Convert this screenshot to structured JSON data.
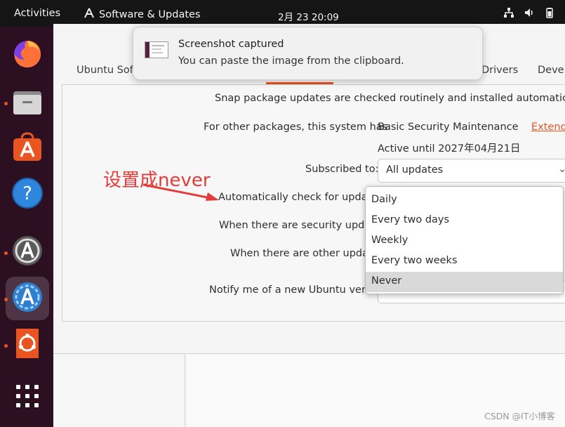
{
  "topbar": {
    "activities": "Activities",
    "app_name": "Software & Updates",
    "clock": "2月 23  20:09",
    "tray_icons": [
      "network-icon",
      "volume-icon",
      "battery-icon"
    ]
  },
  "dock": {
    "items": [
      {
        "name": "firefox-icon",
        "running": false,
        "active": false
      },
      {
        "name": "files-icon",
        "running": true,
        "active": false
      },
      {
        "name": "ubuntu-software-icon",
        "running": false,
        "active": false
      },
      {
        "name": "help-icon",
        "running": false,
        "active": false
      },
      {
        "name": "software-updater-icon",
        "running": true,
        "active": false
      },
      {
        "name": "software-properties-icon",
        "running": true,
        "active": true
      },
      {
        "name": "ubuntu-installer-icon",
        "running": true,
        "active": false
      },
      {
        "name": "show-apps-icon",
        "running": false,
        "active": false
      }
    ]
  },
  "notification": {
    "title": "Screenshot captured",
    "body": "You can paste the image from the clipboard."
  },
  "tabs": [
    {
      "label": "Ubuntu Soft"
    },
    {
      "label": "Drivers"
    },
    {
      "label": "Devel"
    }
  ],
  "updates": {
    "snap_info": "Snap package updates are checked routinely and installed automatically.",
    "other_packages_label": "For other packages, this system has:",
    "maintenance_value": "Basic Security Maintenance",
    "extend_link": "Extend",
    "active_until": "Active until 2027年04月21日",
    "subscribed_label": "Subscribed to:",
    "subscribed_value": "All updates",
    "auto_check_label": "Automatically check for update",
    "security_label": "When there are security update",
    "other_label": "When there are other update",
    "notify_label": "Notify me of a new Ubuntu versio"
  },
  "dropdown": {
    "options": [
      "Daily",
      "Every two days",
      "Weekly",
      "Every two weeks",
      "Never"
    ],
    "selected": "Never"
  },
  "annotation": {
    "text": "设置成never",
    "color": "#e43b3b"
  },
  "watermark": "CSDN @IT小博客",
  "colors": {
    "accent": "#e95420",
    "topbar": "#151515",
    "dock": "#2d0f22"
  }
}
